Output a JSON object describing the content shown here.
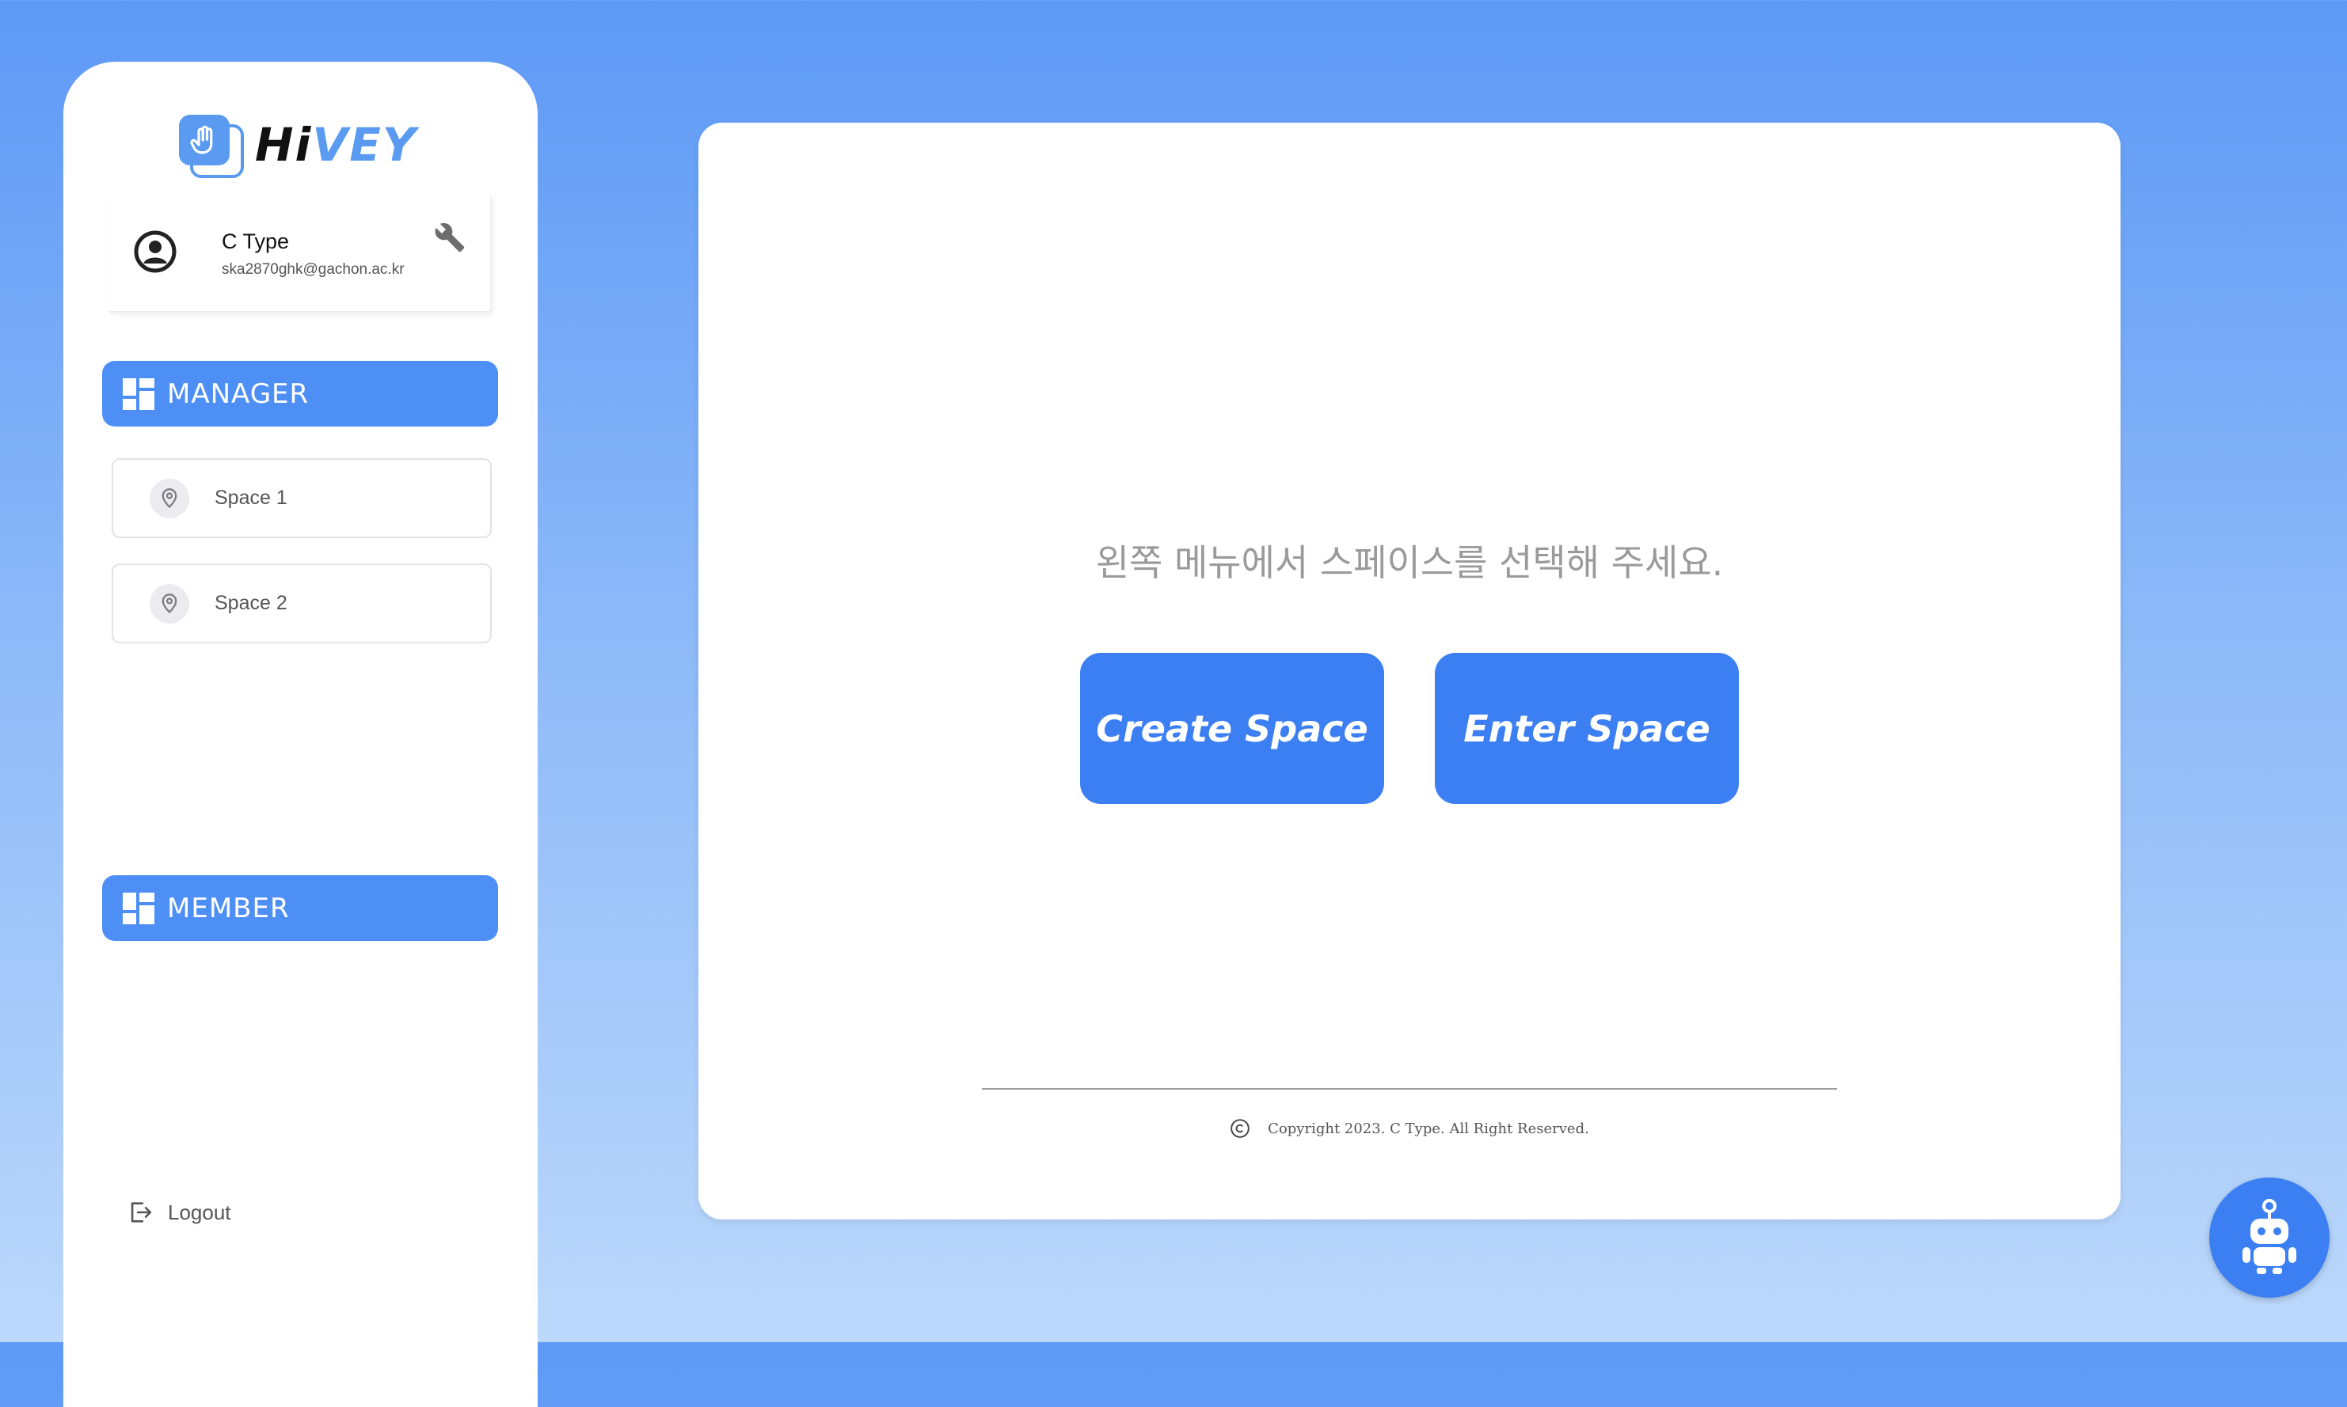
{
  "brand": {
    "part1": "Hi",
    "part2": "VEY",
    "accent": "#5a9af0"
  },
  "profile": {
    "name": "C Type",
    "email": "ska2870ghk@gachon.ac.kr"
  },
  "sidebar": {
    "manager_label": "MANAGER",
    "spaces": [
      {
        "label": "Space 1"
      },
      {
        "label": "Space 2"
      }
    ],
    "member_label": "MEMBER",
    "logout_label": "Logout"
  },
  "main": {
    "prompt": "왼쪽 메뉴에서 스페이스를 선택해 주세요.",
    "create_label": "Create Space",
    "enter_label": "Enter Space",
    "copyright": "Copyright 2023. C Type. All Right Reserved."
  },
  "colors": {
    "primary": "#3b7ff2",
    "section": "#4e8ff5"
  },
  "icons": [
    "hand-icon",
    "user-circle-icon",
    "wrench-icon",
    "dashboard-grid-icon",
    "location-pin-icon",
    "logout-icon",
    "copyright-icon",
    "robot-icon"
  ]
}
